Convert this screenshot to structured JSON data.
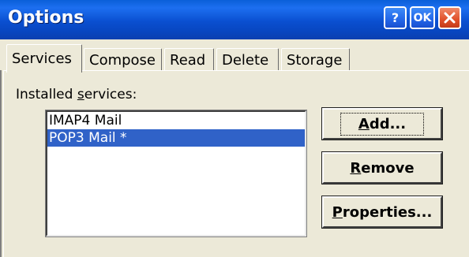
{
  "window": {
    "title": "Options",
    "help_label": "?",
    "ok_label": "OK"
  },
  "tabs": [
    {
      "label": "Services",
      "active": true
    },
    {
      "label": "Compose",
      "active": false
    },
    {
      "label": "Read",
      "active": false
    },
    {
      "label": "Delete",
      "active": false
    },
    {
      "label": "Storage",
      "active": false
    }
  ],
  "services": {
    "label_prefix": "Installed ",
    "label_accel": "s",
    "label_suffix": "ervices:",
    "items": [
      {
        "label": "IMAP4 Mail",
        "selected": false
      },
      {
        "label": "POP3 Mail *",
        "selected": true
      }
    ]
  },
  "buttons": {
    "add": {
      "accel": "A",
      "rest": "dd..."
    },
    "remove": {
      "accel": "R",
      "rest": "emove"
    },
    "properties": {
      "accel": "P",
      "rest": "roperties..."
    }
  },
  "colors": {
    "titlebar": "#0a4fd0",
    "selection": "#3062c8",
    "face": "#ece9d8",
    "close_button": "#e0502a"
  }
}
